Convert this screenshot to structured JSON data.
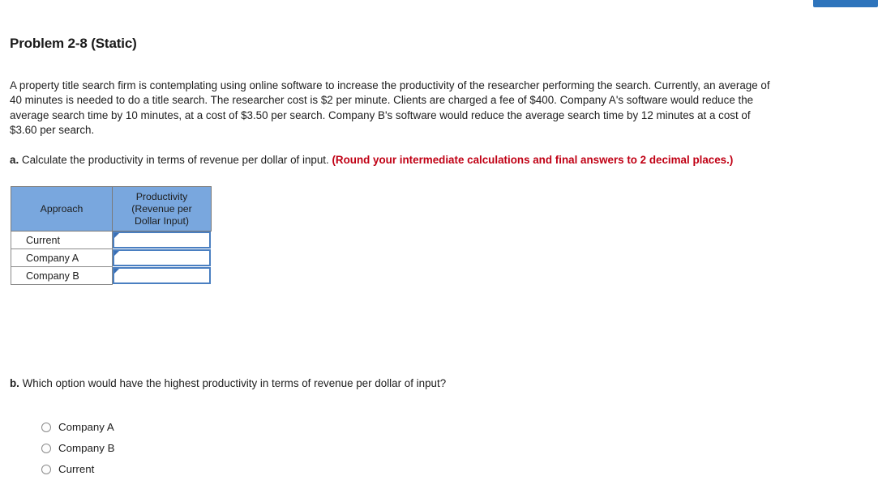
{
  "top_bar": {
    "button_label": "",
    "button_color": "#2e74bc"
  },
  "problem": {
    "title": "Problem 2-8 (Static)",
    "prompt": "A property title search firm is contemplating using online software to increase the productivity of the researcher performing the search. Currently, an average of 40 minutes is needed to do a title search. The researcher cost is $2 per minute. Clients are charged a fee of $400. Company A's software would reduce the average search time by 10 minutes, at a cost of $3.50 per search. Company B's software would reduce the average search time by 12 minutes at a cost of $3.60 per search."
  },
  "part_a": {
    "letter": "a.",
    "text": " Calculate the productivity in terms of revenue per dollar of input. ",
    "round_note": "(Round your intermediate calculations and final answers to 2 decimal places.)",
    "round_note_color": "#c00014",
    "table": {
      "header_color": "#79a7de",
      "columns": [
        "Approach",
        "Productivity\n(Revenue per\nDollar Input)"
      ],
      "column_header_1": "Approach",
      "column_header_2_line1": "Productivity",
      "column_header_2_line2": "(Revenue per",
      "column_header_2_line3": "Dollar Input)",
      "rows": [
        {
          "label": "Current",
          "value": "",
          "placeholder": ""
        },
        {
          "label": "Company A",
          "value": "",
          "placeholder": ""
        },
        {
          "label": "Company B",
          "value": "",
          "placeholder": ""
        }
      ]
    }
  },
  "part_b": {
    "letter": "b.",
    "text": " Which option would have the highest productivity in terms of revenue per dollar of input?",
    "options": [
      {
        "label": "Company A",
        "selected": false
      },
      {
        "label": "Company B",
        "selected": false
      },
      {
        "label": "Current",
        "selected": false
      }
    ]
  }
}
